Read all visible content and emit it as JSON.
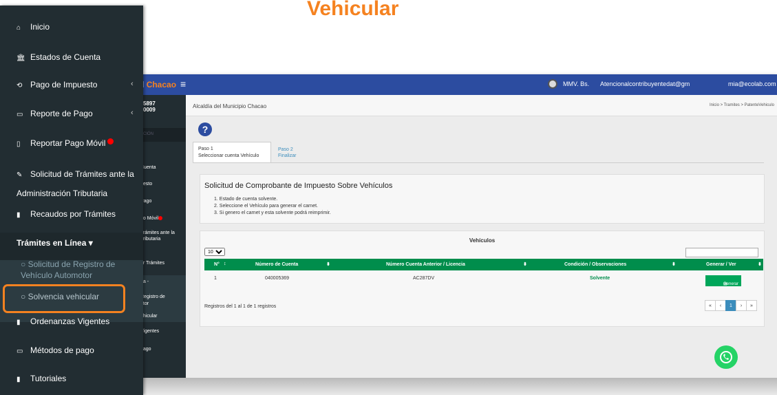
{
  "page_title": "Vehicular",
  "app": {
    "topbar": {
      "brand_prefix": "ual",
      "brand_accent": "Chacao",
      "menu_glyph": "≡",
      "currency": "MMV. Bs.",
      "email1": "Atencionalcontribuyentedat@gm",
      "email2": "mia@ecolab.com"
    },
    "side": {
      "logo_line1": "5897",
      "logo_line2": "0009",
      "search_hint": "ACIÓN",
      "items": [
        "Cuenta",
        "uesto",
        "Pago",
        "go Móvil",
        "Trámites ante la",
        "Tributaria",
        "or Trámites",
        "ea -",
        "Registro de",
        "otor",
        "ehicular",
        "Vigentes",
        "pago"
      ]
    },
    "breadcrumb": {
      "municipality": "Alcaldía del Municipio Chacao",
      "trail": "Inicio  >  Tramites  >  PatenteVehiculo"
    },
    "steps": {
      "step1_title": "Paso 1",
      "step1_desc": "Seleccionar cuenta Vehículo",
      "step2_title": "Paso 2",
      "step2_desc": "Finalizar"
    },
    "info": {
      "title": "Solicitud de Comprobante de Impuesto Sobre Vehículos",
      "lines": [
        "1. Estado de cuenta solvente.",
        "2. Seleccione el Vehículo para generar el carnet.",
        "3. Si genero el carnet y esta solvente podrá reimprimir."
      ]
    },
    "vehicles": {
      "title": "Vehículos",
      "page_size": "10",
      "columns": [
        "N°",
        "Número de Cuenta",
        "Número Cuenta Anterior / Licencia",
        "Condición / Observaciones",
        "Generar / Ver"
      ],
      "rows": [
        {
          "n": "1",
          "cuenta": "040005369",
          "anterior": "AC287DV",
          "condicion": "Solvente",
          "accion": "Generar"
        }
      ],
      "records_text": "Registros del 1 al 1 de 1 registros",
      "pager": [
        "«",
        "‹",
        "1",
        "›",
        "»"
      ]
    }
  },
  "sidebar": {
    "items": [
      {
        "icon": "home-icon",
        "glyph": "⌂",
        "label": "Inicio"
      },
      {
        "icon": "bank-icon",
        "glyph": "🏛",
        "label": "Estados de Cuenta"
      },
      {
        "icon": "refresh-icon",
        "glyph": "⟲",
        "label": "Pago de Impuesto"
      },
      {
        "icon": "card-icon",
        "glyph": "▭",
        "label": "Reporte de Pago"
      },
      {
        "icon": "mobile-icon",
        "glyph": "▯",
        "label": "Reportar Pago Móvil"
      },
      {
        "icon": "edit-icon",
        "glyph": "✎",
        "label": "Solicitud de Trámites ante la Administración Tributaria"
      },
      {
        "icon": "file-icon",
        "glyph": "▮",
        "label": "Recaudos por Trámites"
      }
    ],
    "section_header": "Trámites en Línea",
    "section_caret": "▾",
    "sub_items": [
      "Solicitud de Registro de Vehículo Automotor",
      "Solvencia vehicular"
    ],
    "bottom_items": [
      {
        "icon": "file-icon",
        "glyph": "▮",
        "label": "Ordenanzas Vigentes"
      },
      {
        "icon": "card-icon",
        "glyph": "▭",
        "label": "Métodos de pago"
      },
      {
        "icon": "file-icon",
        "glyph": "▮",
        "label": "Tutoriales"
      }
    ]
  },
  "colors": {
    "brand_orange": "#f58220",
    "sidebar_bg": "#222d32",
    "topbar_blue": "#2c4ca0",
    "table_green": "#008d4c",
    "whatsapp_green": "#25d366"
  }
}
